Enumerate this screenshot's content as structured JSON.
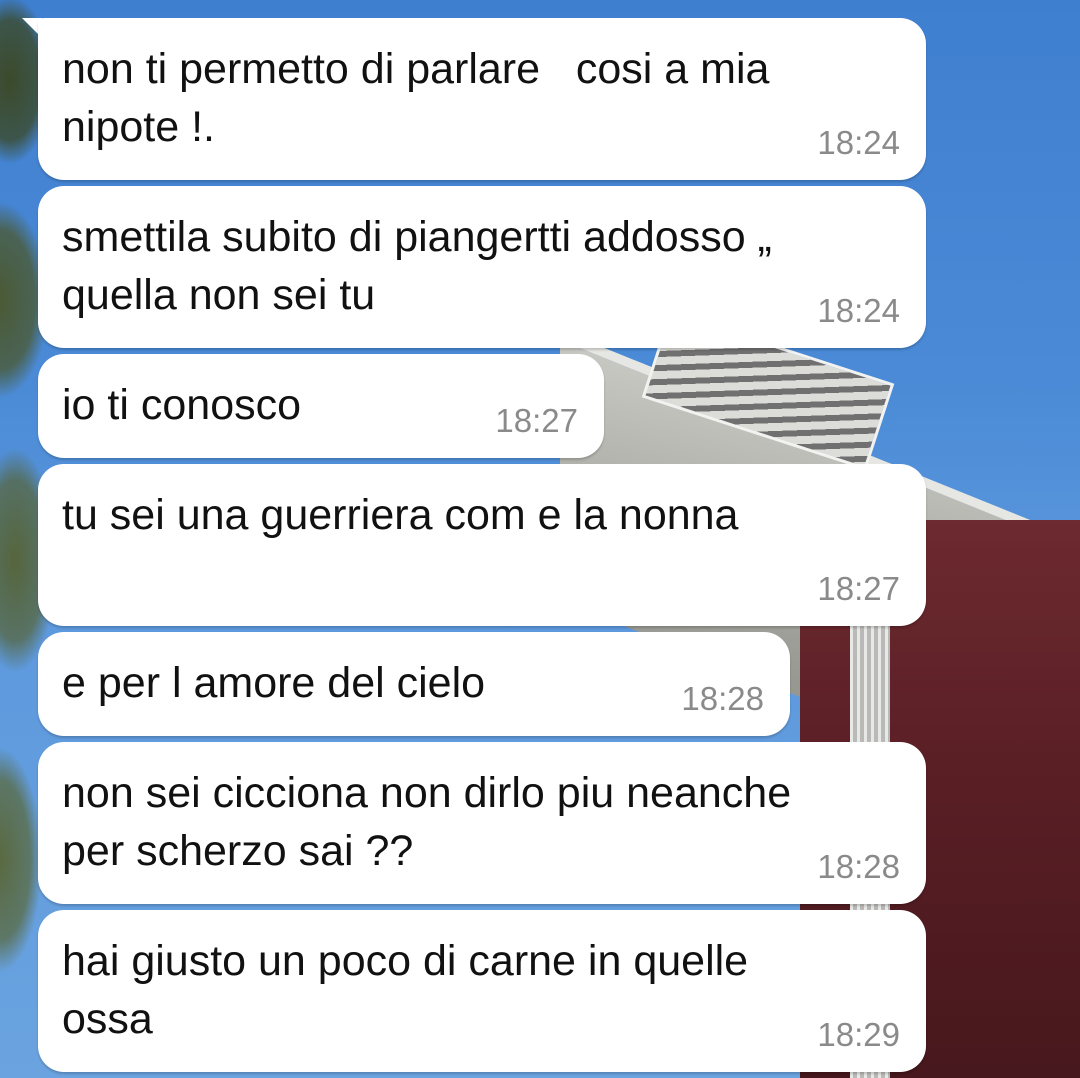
{
  "chat": {
    "messages": [
      {
        "text": "non ti permetto di parlare   cosi a mia\nnipote !.",
        "time": "18:24"
      },
      {
        "text": "smettila subito di piangertti addosso „\nquella non sei tu",
        "time": "18:24"
      },
      {
        "text": "io ti conosco",
        "time": "18:27"
      },
      {
        "text": "tu sei una guerriera com e la nonna",
        "time": "18:27"
      },
      {
        "text": "e per l amore del cielo",
        "time": "18:28"
      },
      {
        "text": "non sei cicciona non dirlo piu neanche\nper scherzo sai ??",
        "time": "18:28"
      },
      {
        "text": "hai giusto un poco di carne in quelle\nossa",
        "time": "18:29"
      }
    ]
  },
  "colors": {
    "bubble_bg": "#ffffff",
    "text": "#111111",
    "timestamp": "#8a8a8a",
    "sky": "#4a8ad6"
  },
  "icons": [
    "chat-bubble-tail"
  ]
}
